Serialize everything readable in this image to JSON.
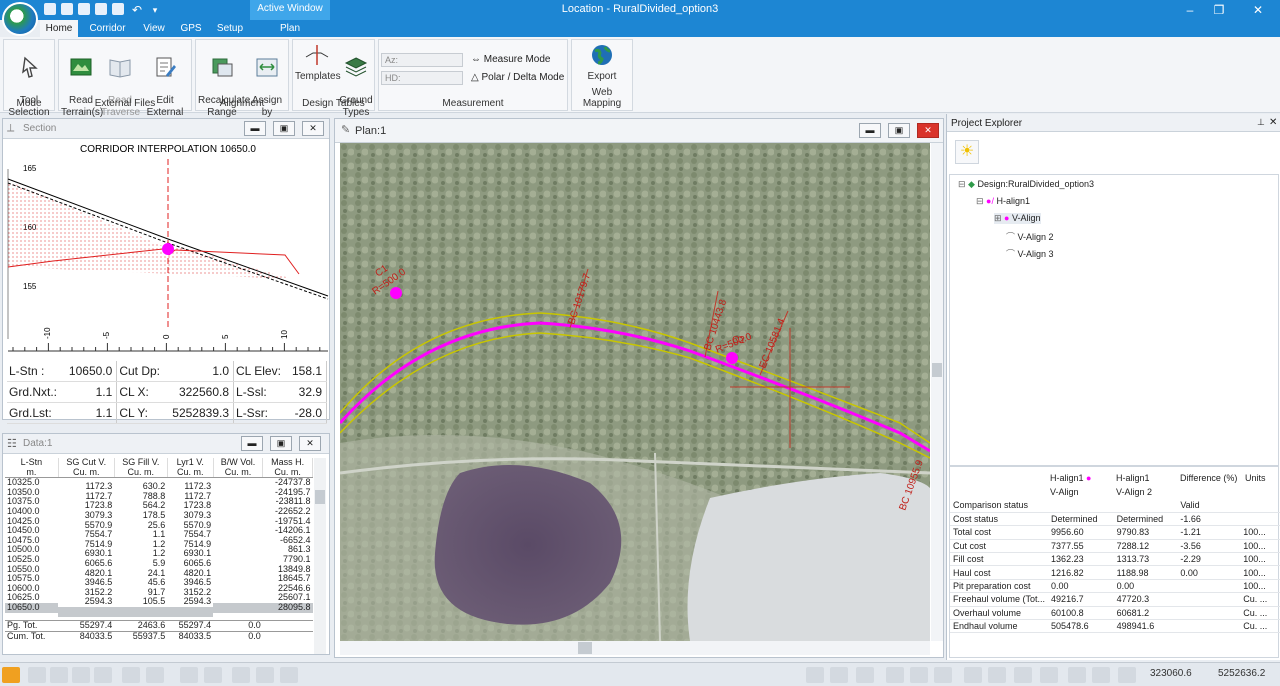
{
  "window": {
    "title": "Location - RuralDivided_option3",
    "context_tab": "Active Window"
  },
  "tabs": [
    {
      "label": "Home",
      "active": true
    },
    {
      "label": "Corridor"
    },
    {
      "label": "View"
    },
    {
      "label": "GPS"
    },
    {
      "label": "Setup"
    },
    {
      "label": "Plan"
    }
  ],
  "ribbon": {
    "mode": {
      "label": "Mode",
      "tool_selection": "Tool\nSelection ▾"
    },
    "external_files": {
      "label": "External Files",
      "read_terrain": "Read\nTerrain(s)",
      "read_traverse": "Read\nTraverse",
      "edit_external": "Edit External\nFiles"
    },
    "alignment": {
      "label": "Alignment",
      "recalculate": "Recalculate\nRange",
      "assign": "Assign\nby Range"
    },
    "design_tables": {
      "label": "Design Tables",
      "templates": "Templates",
      "ground_types": "Ground\nTypes"
    },
    "measurement": {
      "label": "Measurement",
      "az_placeholder": "Az:",
      "hd_placeholder": "HD:",
      "measure_mode": "Measure Mode",
      "polar_mode": "Polar / Delta Mode"
    },
    "web_mapping": {
      "label": "Web Mapping",
      "export": "Export"
    }
  },
  "section": {
    "title": "Section",
    "chart_title": "CORRIDOR INTERPOLATION 10650.0",
    "y_ticks": [
      "165",
      "160",
      "155"
    ],
    "x_ticks": [
      "-10",
      "-5",
      "0",
      "5",
      "10"
    ],
    "readouts": [
      {
        "l1": "L-Stn :",
        "v1": "10650.0",
        "l2": "Cut Dp:",
        "v2": "1.0",
        "l3": "CL Elev:",
        "v3": "158.1"
      },
      {
        "l1": "Grd.Nxt.:",
        "v1": "1.1",
        "l2": "CL X:",
        "v2": "322560.8",
        "l3": "L-Ssl:",
        "v3": "32.9"
      },
      {
        "l1": "Grd.Lst:",
        "v1": "1.1",
        "l2": "CL Y:",
        "v2": "5252839.3",
        "l3": "L-Ssr:",
        "v3": "-28.0"
      }
    ]
  },
  "data_panel": {
    "title": "Data:1",
    "headers": [
      [
        "L-Stn",
        "m."
      ],
      [
        "SG Cut V.",
        "Cu. m."
      ],
      [
        "SG Fill V.",
        "Cu. m."
      ],
      [
        "Lyr1 V.",
        "Cu. m."
      ],
      [
        "B/W Vol.",
        "Cu. m."
      ],
      [
        "Mass H.",
        "Cu. m."
      ]
    ],
    "stations": [
      "10325.0",
      "10350.0",
      "10375.0",
      "10400.0",
      "10425.0",
      "10450.0",
      "10475.0",
      "10500.0",
      "10525.0",
      "10550.0",
      "10575.0",
      "10600.0",
      "10625.0",
      "10650.0"
    ],
    "cut": [
      "1172.3",
      "1172.7",
      "1723.8",
      "3079.3",
      "5570.9",
      "7554.7",
      "7514.9",
      "6930.1",
      "6065.6",
      "4820.1",
      "3946.5",
      "3152.2",
      "2594.3"
    ],
    "fill": [
      "630.2",
      "788.8",
      "564.2",
      "178.5",
      "25.6",
      "1.1",
      "1.2",
      "1.2",
      "5.9",
      "24.1",
      "45.6",
      "91.7",
      "105.5"
    ],
    "lyr1": [
      "1172.3",
      "1172.7",
      "1723.8",
      "3079.3",
      "5570.9",
      "7554.7",
      "7514.9",
      "6930.1",
      "6065.6",
      "4820.1",
      "3946.5",
      "3152.2",
      "2594.3"
    ],
    "mass": [
      "-24737.8",
      "-24195.7",
      "-23811.8",
      "-22652.2",
      "-19751.4",
      "-14206.1",
      "-6652.4",
      "861.3",
      "7790.1",
      "13849.8",
      "18645.7",
      "22546.6",
      "25607.1",
      "28095.8"
    ],
    "selected_station": "10650.0",
    "totals": [
      {
        "label": "Pg. Tot.",
        "cut": "55297.4",
        "fill": "2463.6",
        "lyr1": "55297.4",
        "bw": "0.0"
      },
      {
        "label": "Cum. Tot.",
        "cut": "84033.5",
        "fill": "55937.5",
        "lyr1": "84033.5",
        "bw": "0.0"
      }
    ]
  },
  "plan": {
    "title": "Plan:1",
    "labels": {
      "c1_name": "C1",
      "c1_radius": "R=500.0",
      "c2_name": "C2",
      "c2_radius": "R=500.0",
      "bc1": "BC 10179.7",
      "bc2": "BC 10443.8",
      "ec1": "EC 10581.4",
      "bc3": "BC 10955.9"
    }
  },
  "explorer": {
    "title": "Project Explorer",
    "tree": {
      "design": "Design:RuralDivided_option3",
      "halign": "H-align1",
      "valigns": [
        "V-Align",
        "V-Align 2",
        "V-Align 3"
      ]
    },
    "compare_head": {
      "col1_top": "H-align1",
      "col1_bot": "V-Align",
      "col2_top": "H-align1",
      "col2_bot": "V-Align 2",
      "diff": "Difference (%)",
      "units": "Units"
    },
    "rows": [
      {
        "name": "Comparison status",
        "a": "",
        "b": "",
        "d": "Valid",
        "u": ""
      },
      {
        "name": "Cost status",
        "a": "Determined",
        "b": "Determined",
        "d": "-1.66",
        "u": ""
      },
      {
        "name": "Total cost",
        "a": "9956.60",
        "b": "9790.83",
        "d": "-1.21",
        "u": "100..."
      },
      {
        "name": "Cut cost",
        "a": "7377.55",
        "b": "7288.12",
        "d": "-3.56",
        "u": "100..."
      },
      {
        "name": "Fill cost",
        "a": "1362.23",
        "b": "1313.73",
        "d": "-2.29",
        "u": "100..."
      },
      {
        "name": "Haul cost",
        "a": "1216.82",
        "b": "1188.98",
        "d": "0.00",
        "u": "100..."
      },
      {
        "name": "Pit preparation cost",
        "a": "0.00",
        "b": "0.00",
        "d": "",
        "u": "100..."
      },
      {
        "name": "Freehaul volume (Tot...",
        "a": "49216.7",
        "b": "47720.3",
        "d": "",
        "u": "Cu. ..."
      },
      {
        "name": "Overhaul volume",
        "a": "60100.8",
        "b": "60681.2",
        "d": "",
        "u": "Cu. ..."
      },
      {
        "name": "Endhaul volume",
        "a": "505478.6",
        "b": "498941.6",
        "d": "",
        "u": "Cu. ..."
      }
    ]
  },
  "statusbar": {
    "x": "323060.6",
    "y": "5252636.2"
  }
}
